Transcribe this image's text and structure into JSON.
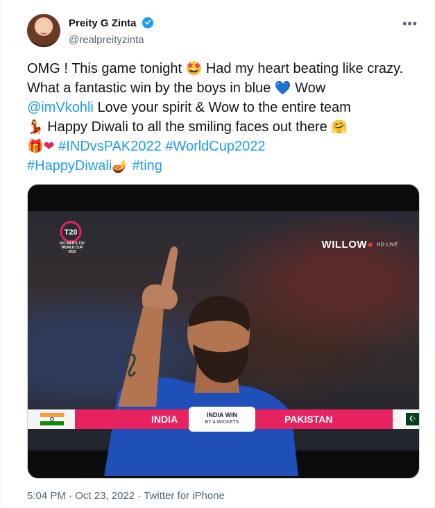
{
  "author": {
    "display_name": "Preity G Zinta",
    "handle": "@realpreityzinta"
  },
  "more_label": "•••",
  "tweet": {
    "line1_a": "OMG ! This game tonight ",
    "emoji_starstruck": "🤩",
    "line1_b": " Had my heart beating like crazy. What a fantastic win by the boys in blue ",
    "emoji_blue_heart": "💙",
    "line1_c": " Wow ",
    "mention": "@imVkohli",
    "line2": " Love your spirit & Wow to the entire team ",
    "emoji_dancer": "💃",
    "line3": " Happy Diwali to all the smiling faces out there ",
    "emoji_hug": "🤗",
    "emoji_gift": "🎁",
    "emoji_heart": "❤",
    "hashtag1": "#INDvsPAK2022",
    "hashtag2": "#WorldCup2022",
    "hashtag3": "#HappyDiwali",
    "emoji_diya": "🪔",
    "hashtag4": "#ting"
  },
  "media": {
    "broadcaster": "WILLOW",
    "broadcaster_sub": "HD LIVE",
    "tournament_logo": "T20",
    "tournament_text": "ICC MEN'S T20 WORLD CUP 2022",
    "team_left": "INDIA",
    "team_right": "PAKISTAN",
    "result_main": "INDIA WIN",
    "result_sub": "BY 4 WICKETS"
  },
  "footer": {
    "time": "5:04 PM",
    "sep1": " · ",
    "date": "Oct 23, 2022",
    "sep2": " · ",
    "source": "Twitter for iPhone"
  },
  "colors": {
    "link": "#1d9bf0",
    "verified": "#1d9bf0",
    "score_bar": "#e8225f"
  }
}
